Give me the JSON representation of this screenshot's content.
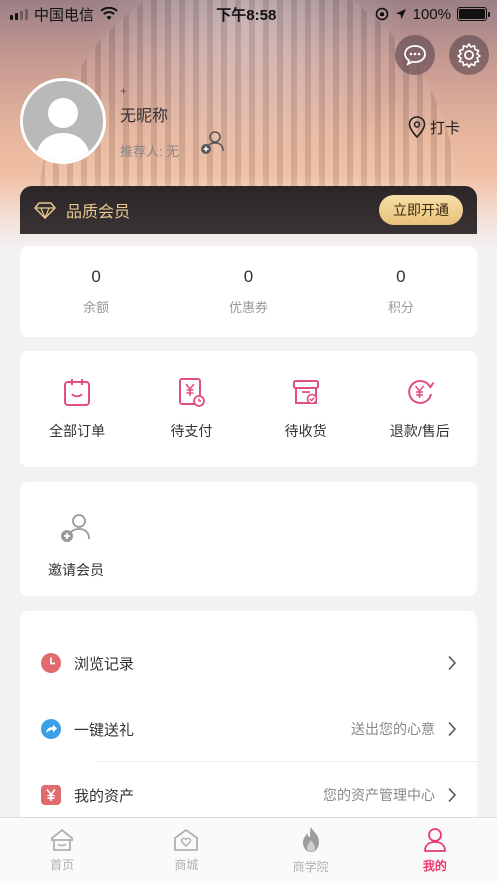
{
  "status_bar": {
    "carrier": "中国电信",
    "time": "下午8:58",
    "battery": "100%"
  },
  "header": {
    "message_icon": "chat-bubble-icon",
    "settings_icon": "gear-icon",
    "plus_mark": "+",
    "nickname": "无昵称",
    "recommender": "推荐人: 无",
    "checkin_label": "打卡"
  },
  "vip": {
    "label": "品质会员",
    "button": "立即开通",
    "accent": "#e9c88f"
  },
  "stats": [
    {
      "value": "0",
      "label": "余额"
    },
    {
      "value": "0",
      "label": "优惠券"
    },
    {
      "value": "0",
      "label": "积分"
    }
  ],
  "orders": [
    {
      "label": "全部订单",
      "icon": "clipboard-icon"
    },
    {
      "label": "待支付",
      "icon": "yuan-bill-icon"
    },
    {
      "label": "待收货",
      "icon": "box-icon"
    },
    {
      "label": "退款/售后",
      "icon": "refund-icon"
    }
  ],
  "invite": {
    "label": "邀请会员",
    "icon": "add-user-icon"
  },
  "menu": [
    {
      "title": "浏览记录",
      "hint": "",
      "icon": "clock-icon",
      "color": "#e06b6f"
    },
    {
      "title": "一键送礼",
      "hint": "送出您的心意",
      "icon": "share-arrow-icon",
      "color": "#3aa1e8"
    },
    {
      "title": "我的资产",
      "hint": "您的资产管理中心",
      "icon": "yuan-icon",
      "color": "#e06b6f"
    }
  ],
  "tabbar": [
    {
      "label": "首页",
      "icon": "home-icon"
    },
    {
      "label": "商城",
      "icon": "shop-icon"
    },
    {
      "label": "商学院",
      "icon": "flame-icon"
    },
    {
      "label": "我的",
      "icon": "person-icon"
    }
  ],
  "colors": {
    "accent": "#e93a6d",
    "icon_red": "#e0507a"
  }
}
